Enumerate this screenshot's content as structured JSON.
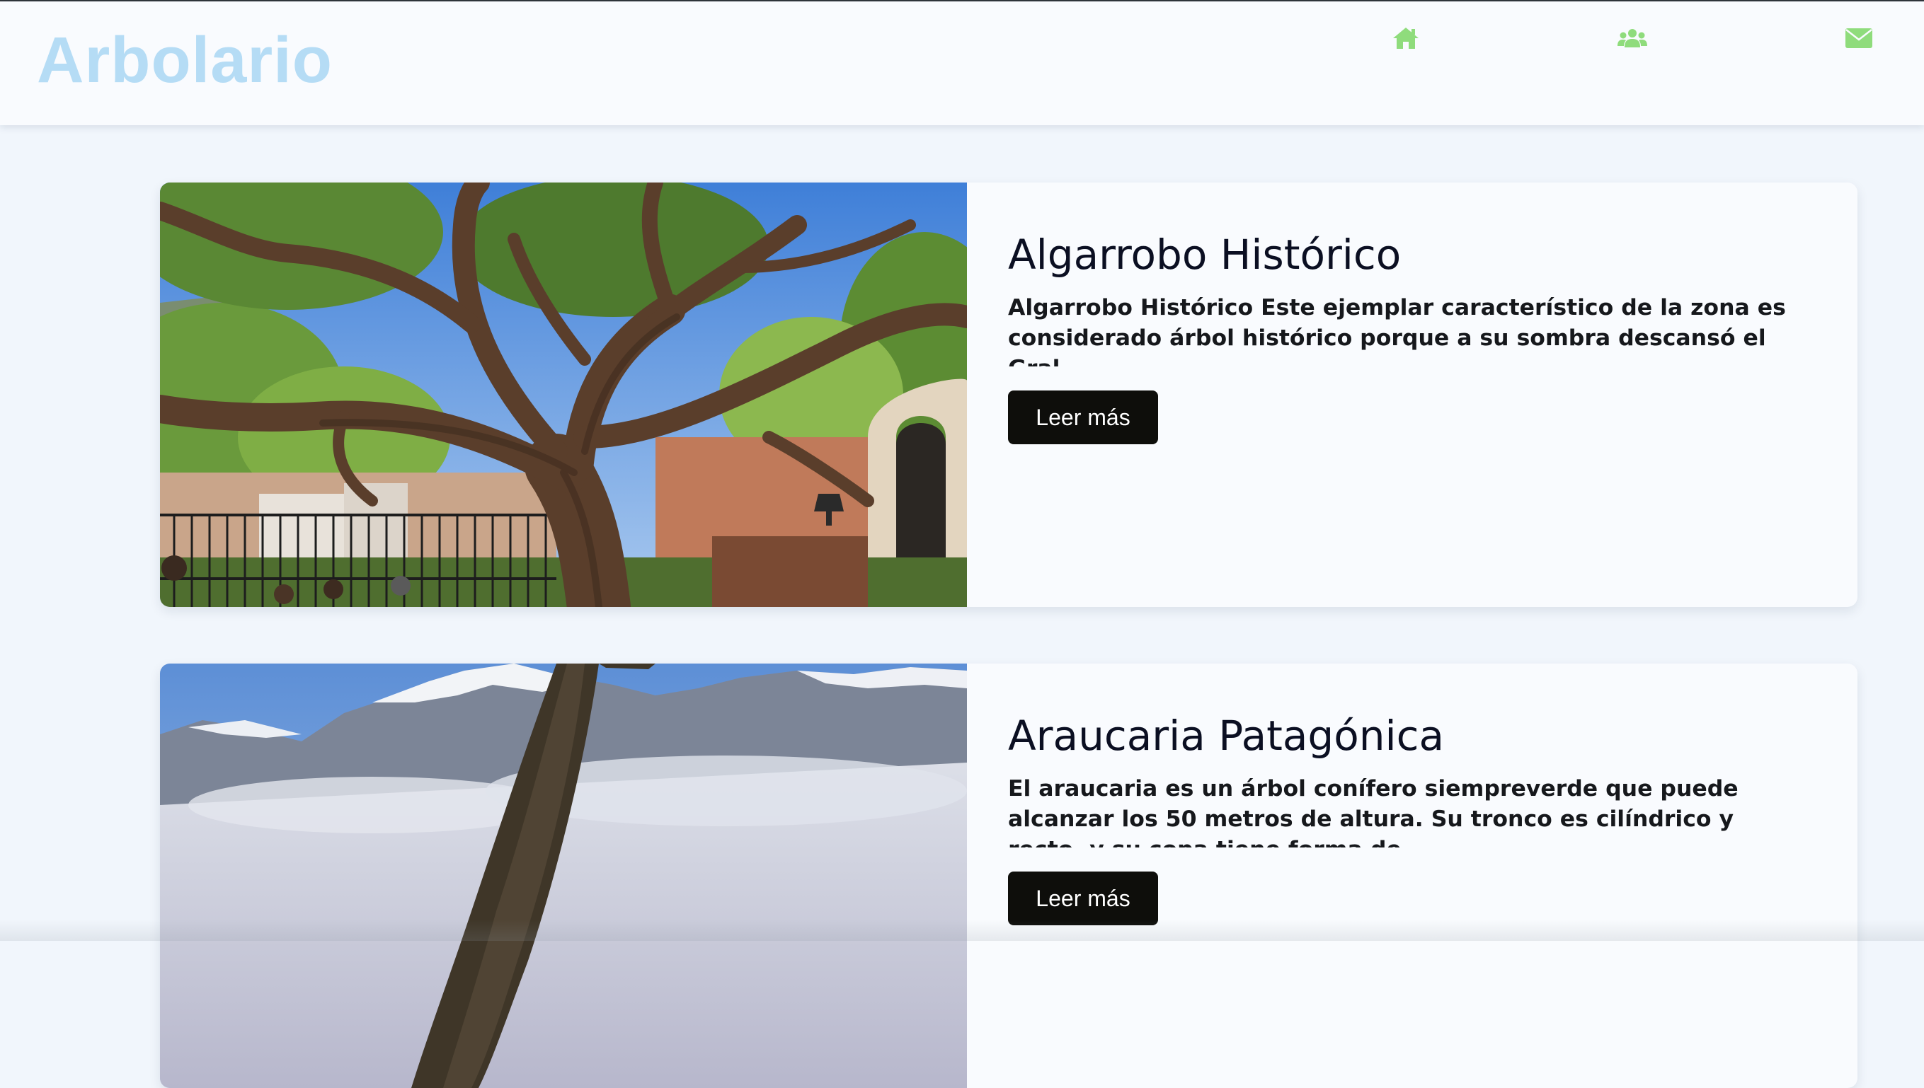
{
  "header": {
    "logo_text": "Arbolario",
    "nav": [
      {
        "icon": "home-icon",
        "color": "#8fdc7c"
      },
      {
        "icon": "users-icon",
        "color": "#8fdc7c"
      },
      {
        "icon": "envelope-icon",
        "color": "#8fdc7c"
      }
    ]
  },
  "colors": {
    "logo": "#b5dcf5",
    "nav_icon": "#8fdc7c",
    "button_bg": "#0e0e0b",
    "page_bg": "#f1f6fc",
    "card_bg": "#f9fbfe"
  },
  "cards": [
    {
      "title": "Algarrobo Histórico",
      "description": "Algarrobo Histórico Este ejemplar característico de la zona es considerado árbol histórico porque a su sombra descansó el Gral.",
      "button_label": "Leer más",
      "image": "algarrobo-tree-photo"
    },
    {
      "title": "Araucaria Patagónica",
      "description": "El araucaria es un árbol conífero siempreverde que puede alcanzar los 50 metros de altura. Su tronco es cilíndrico y recto, y su copa tiene forma de",
      "button_label": "Leer más",
      "image": "araucaria-mountain-photo"
    }
  ]
}
